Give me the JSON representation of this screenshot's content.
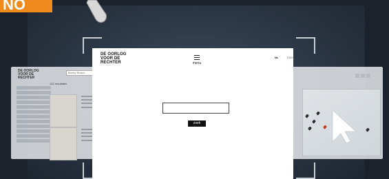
{
  "corner_tag": {
    "text": "NO"
  },
  "modal": {
    "logo_lines": [
      "DE OORLOG",
      "VOOR DE",
      "RECHTER"
    ],
    "menu_label": "menu",
    "lang": {
      "nl": "NL",
      "eng": "ENG"
    },
    "search": {
      "value": "",
      "placeholder": ""
    },
    "search_button_label": "zoek"
  },
  "background_screen": {
    "logo_lines": [
      "DE OORLOG",
      "VOOR DE",
      "RECHTER"
    ],
    "search_value": "Bonny Brown",
    "results_label": "102 resultaten"
  },
  "colors": {
    "accent_orange": "#f18a1d",
    "modal_bg": "#ffffff",
    "button_bg": "#111111",
    "map_pin_red": "#c0392b"
  },
  "icons": [
    "hamburger-menu-icon",
    "cursor-arrow-icon",
    "map-pin-icon",
    "pointing-finger-icon"
  ]
}
